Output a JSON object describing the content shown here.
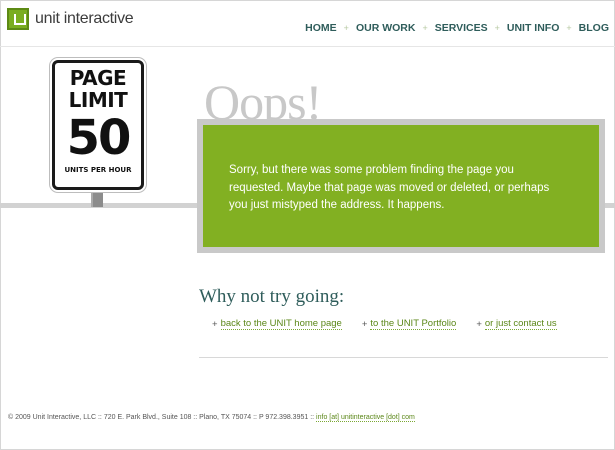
{
  "logo": {
    "text": "unit interactive"
  },
  "nav": {
    "items": [
      {
        "label": "HOME"
      },
      {
        "label": "OUR WORK"
      },
      {
        "label": "SERVICES"
      },
      {
        "label": "UNIT INFO"
      },
      {
        "label": "BLOG"
      }
    ],
    "separator": "+"
  },
  "sign": {
    "line1": "PAGE",
    "line2": "LIMIT",
    "number": "50",
    "units": "UNITS PER HOUR"
  },
  "error": {
    "heading": "Oops!",
    "message": "Sorry, but there was some problem finding the page you requested. Maybe that page was moved or deleted, or perhaps you just mistyped the address. It happens."
  },
  "suggestions": {
    "heading": "Why not try going:",
    "links": [
      {
        "label": "back to the UNIT home page"
      },
      {
        "label": "to the UNIT Portfolio"
      },
      {
        "label": "or just contact us"
      }
    ]
  },
  "footer": {
    "text": "© 2009 Unit Interactive, LLC :: 720 E. Park Blvd., Suite 108 :: Plano, TX 75074 :: P 972.398.3951 ::",
    "email": "info [at] unitinteractive [dot] com"
  },
  "colors": {
    "accent_green": "#82b022",
    "nav_teal": "#2f5d5b",
    "oops_gray": "#c8c8c8"
  }
}
